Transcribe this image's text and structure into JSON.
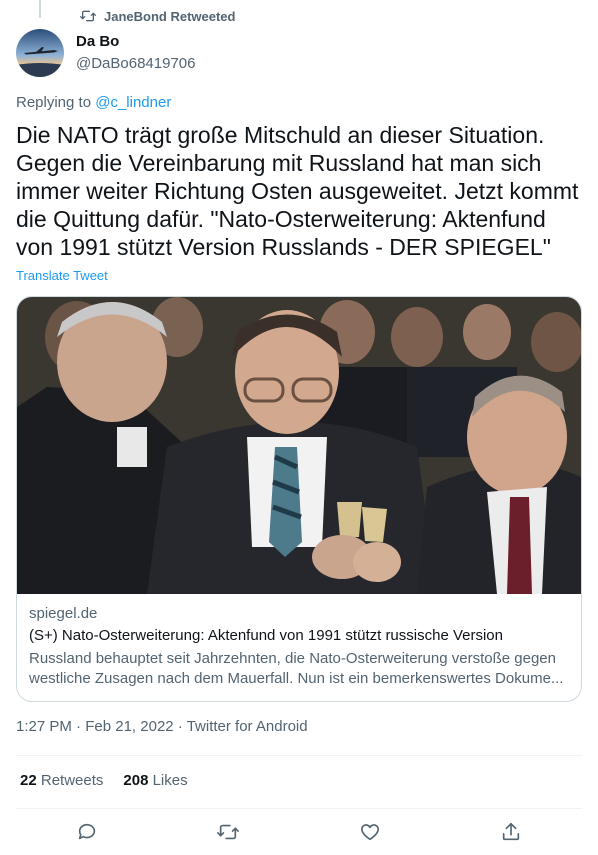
{
  "retweet": {
    "label": "JaneBond Retweeted",
    "icon": "retweet-icon"
  },
  "author": {
    "display_name": "Da Bo",
    "handle": "@DaBo68419706",
    "avatar": "airplane-sunset-avatar"
  },
  "reply": {
    "prefix": "Replying to",
    "mention": "@c_lindner"
  },
  "tweet": {
    "text": "Die NATO trägt große Mitschuld an dieser Situation. Gegen die Vereinbarung mit Russland hat man sich immer weiter Richtung Osten ausgeweitet. Jetzt kommt die Quittung dafür. \"Nato-Osterweiterung: Aktenfund von 1991 stützt Version Russlands - DER SPIEGEL\"",
    "translate_label": "Translate Tweet"
  },
  "card": {
    "image": "photo-of-politicians-toasting-with-champagne",
    "domain": "spiegel.de",
    "title": "(S+) Nato-Osterweiterung: Aktenfund von 1991 stützt russische Version",
    "description": "Russland behauptet seit Jahrzehnten, die Nato-Osterweiterung verstoße gegen westliche Zusagen nach dem Mauerfall. Nun ist ein bemerkenswertes Dokume..."
  },
  "meta": {
    "time": "1:27 PM",
    "date": "Feb 21, 2022",
    "source": "Twitter for Android",
    "separator": "·"
  },
  "stats": {
    "retweets_count": "22",
    "retweets_label": "Retweets",
    "likes_count": "208",
    "likes_label": "Likes"
  },
  "actions": [
    "reply-icon",
    "retweet-icon",
    "like-icon",
    "share-icon"
  ],
  "colors": {
    "accent": "#1d9bf0",
    "secondary_text": "#536471",
    "primary_text": "#0f1419",
    "border": "#cfd9de"
  }
}
